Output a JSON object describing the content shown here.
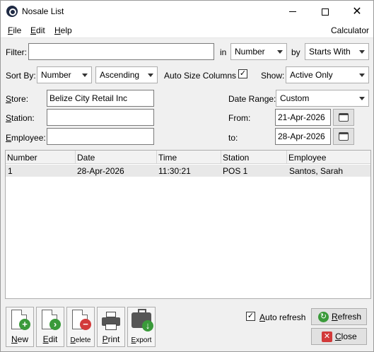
{
  "window": {
    "title": "Nosale List"
  },
  "menu": {
    "file": "File",
    "file_rest": "ile",
    "file_hot": "F",
    "edit_hot": "E",
    "edit_rest": "dit",
    "help_hot": "H",
    "help_rest": "elp",
    "calculator": "Calculator"
  },
  "filter": {
    "label": "Filter:",
    "value": "",
    "in_label": "in",
    "in_value": "Number",
    "by_label": "by",
    "by_value": "Starts With"
  },
  "sort": {
    "label": "Sort By:",
    "field": "Number",
    "order": "Ascending",
    "autosize_label": "Auto Size Columns",
    "autosize_checked": "✓",
    "show_label": "Show:",
    "show_value": "Active Only"
  },
  "store": {
    "label_hot": "S",
    "label_rest": "tore:",
    "value": "Belize City Retail Inc"
  },
  "station": {
    "label_hot": "S",
    "label_rest": "tation:",
    "value": ""
  },
  "employee": {
    "label_hot": "E",
    "label_rest": "mployee:",
    "value": ""
  },
  "daterange": {
    "label": "Date Range:",
    "value": "Custom",
    "from_label": "From:",
    "from_value": "21-Apr-2026",
    "to_label": "to:",
    "to_value": "28-Apr-2026"
  },
  "grid": {
    "columns": [
      "Number",
      "Date",
      "Time",
      "Station",
      "Employee"
    ],
    "rows": [
      [
        "1",
        "28-Apr-2026",
        "11:30:21",
        "POS 1",
        "Santos, Sarah"
      ]
    ]
  },
  "toolbar": {
    "new_hot": "N",
    "new_rest": "ew",
    "edit_hot": "E",
    "edit_rest": "dit",
    "delete_hot": "D",
    "delete_rest": "elete",
    "print_hot": "P",
    "print_rest": "rint",
    "export_hot": "E",
    "export_rest": "xport"
  },
  "bottom": {
    "auto_refresh_hot": "A",
    "auto_refresh_rest": "uto refresh",
    "auto_refresh_checked": "✓",
    "refresh_hot": "R",
    "refresh_rest": "efresh",
    "close_hot": "C",
    "close_rest": "lose"
  },
  "colors": {
    "green": "#3a9a3a",
    "red": "#d23a3a",
    "blue": "#2a7fd4"
  }
}
